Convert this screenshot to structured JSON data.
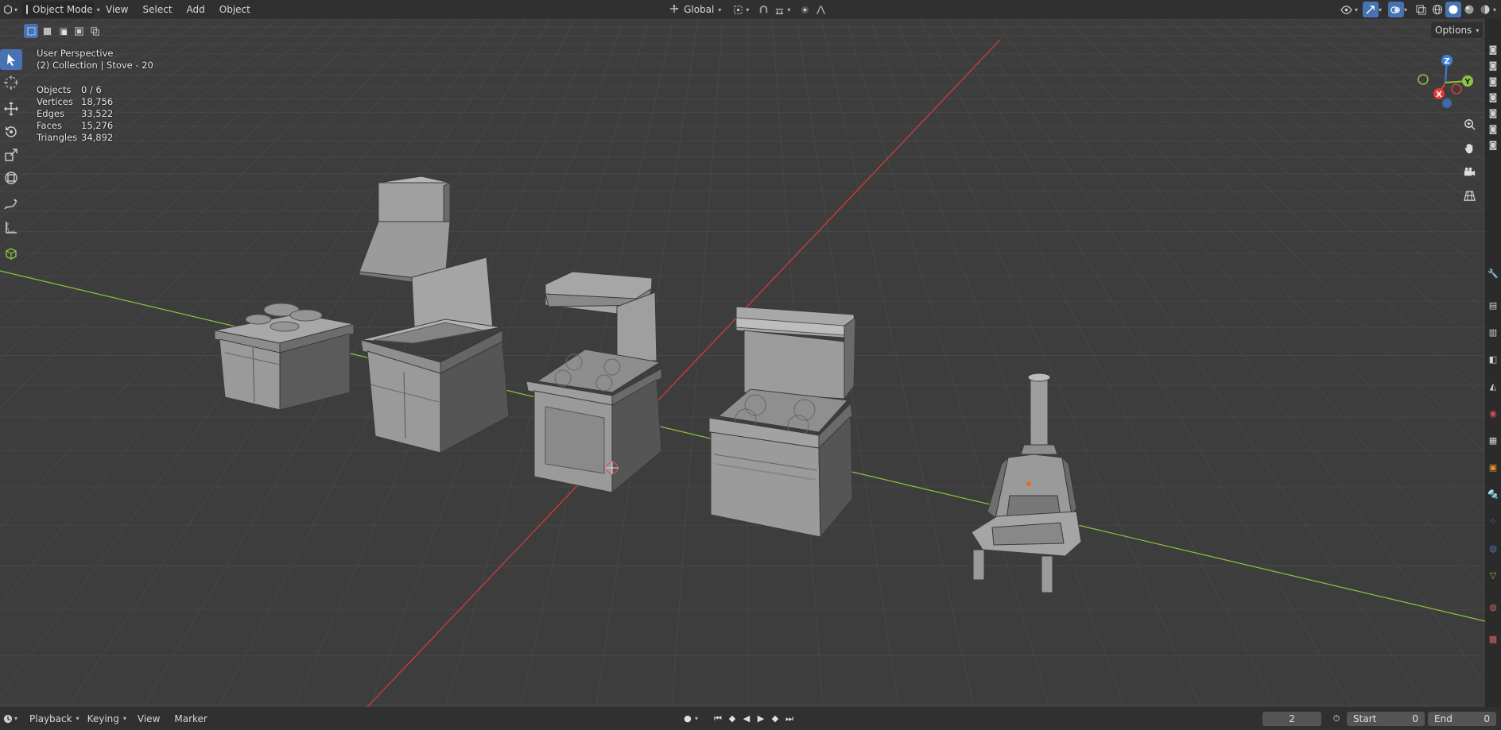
{
  "header": {
    "editor_icon": "view3d-icon",
    "mode": "Object Mode",
    "menus": [
      "View",
      "Select",
      "Add",
      "Object"
    ],
    "orientation": "Global",
    "options_label": "Options"
  },
  "viewport": {
    "perspective": "User Perspective",
    "collection": "(2) Collection | Stove - 20",
    "stats": [
      {
        "label": "Objects",
        "value": "0 / 6"
      },
      {
        "label": "Vertices",
        "value": "18,756"
      },
      {
        "label": "Edges",
        "value": "33,522"
      },
      {
        "label": "Faces",
        "value": "15,276"
      },
      {
        "label": "Triangles",
        "value": "34,892"
      }
    ],
    "gizmo": {
      "x": "X",
      "y": "Y",
      "z": "Z"
    }
  },
  "tools": [
    {
      "name": "select-box-tool",
      "icon": "cursor-arrow-icon"
    },
    {
      "name": "cursor-tool",
      "icon": "crosshair-icon"
    },
    {
      "name": "move-tool",
      "icon": "move-arrows-icon"
    },
    {
      "name": "rotate-tool",
      "icon": "rotate-icon"
    },
    {
      "name": "scale-tool",
      "icon": "scale-icon"
    },
    {
      "name": "transform-tool",
      "icon": "transform-icon"
    },
    {
      "name": "annotate-tool",
      "icon": "annotate-pen-icon"
    },
    {
      "name": "measure-tool",
      "icon": "ruler-icon"
    },
    {
      "name": "add-cube-tool",
      "icon": "cube-add-icon"
    }
  ],
  "timeline": {
    "menus": [
      "Playback",
      "Keying",
      "View",
      "Marker"
    ],
    "current_frame": "2",
    "start_label": "Start",
    "start_value": "0",
    "end_label": "End",
    "end_value": "0"
  },
  "colors": {
    "accent": "#4772b3",
    "x_axis": "#e23a3a",
    "y_axis": "#8bc53f",
    "z_axis": "#3e7fd8"
  }
}
